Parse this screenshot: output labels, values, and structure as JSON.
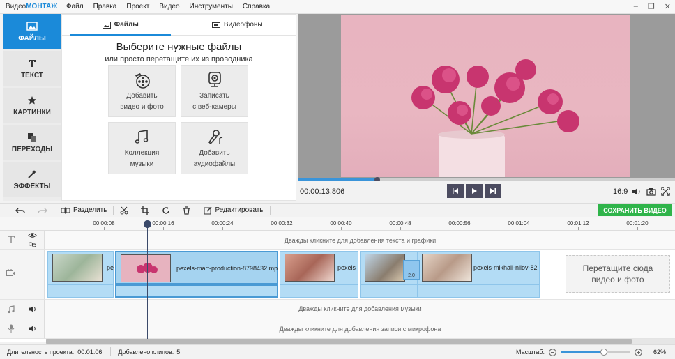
{
  "app": {
    "title_prefix": "Видео",
    "title_brand": "МОНТАЖ"
  },
  "menu": [
    "Файл",
    "Правка",
    "Проект",
    "Видео",
    "Инструменты",
    "Справка"
  ],
  "sidebar": {
    "items": [
      {
        "label": "ФАЙЛЫ",
        "icon": "image-icon",
        "active": true
      },
      {
        "label": "ТЕКСТ",
        "icon": "text-icon",
        "active": false
      },
      {
        "label": "КАРТИНКИ",
        "icon": "star-icon",
        "active": false
      },
      {
        "label": "ПЕРЕХОДЫ",
        "icon": "transitions-icon",
        "active": false
      },
      {
        "label": "ЭФФЕКТЫ",
        "icon": "magic-wand-icon",
        "active": false
      }
    ]
  },
  "files_panel": {
    "tabs": [
      {
        "label": "Файлы",
        "icon": "image-icon"
      },
      {
        "label": "Видеофоны",
        "icon": "film-icon"
      }
    ],
    "heading": "Выберите нужные файлы",
    "subheading": "или просто перетащите их из проводника",
    "tiles": [
      {
        "line1": "Добавить",
        "line2": "видео и фото",
        "icon": "film-reel-icon"
      },
      {
        "line1": "Записать",
        "line2": "с веб-камеры",
        "icon": "webcam-icon"
      },
      {
        "line1": "Коллекция",
        "line2": "музыки",
        "icon": "music-notes-icon"
      },
      {
        "line1": "Добавить",
        "line2": "аудиофайлы",
        "icon": "microphone-icon"
      }
    ]
  },
  "player": {
    "timecode": "00:00:13.806",
    "progress_fraction": 0.211,
    "aspect": "16:9"
  },
  "toolbar": {
    "split_label": "Разделить",
    "edit_label": "Редактировать",
    "save_label": "СОХРАНИТЬ ВИДЕО"
  },
  "ruler": {
    "ticks": [
      "00:00:08",
      "00:00:16",
      "00:00:24",
      "00:00:32",
      "00:00:40",
      "00:00:48",
      "00:00:56",
      "00:01:04",
      "00:01:12",
      "00:01:20"
    ]
  },
  "timeline": {
    "text_hint": "Дважды кликните для добавления текста и графики",
    "music_hint": "Дважды кликните для добавления музыки",
    "mic_hint": "Дважды кликните для добавления записи с микрофона",
    "dropzone": [
      "Перетащите сюда",
      "видео и фото"
    ],
    "clips": [
      {
        "label": "pe",
        "selected": false
      },
      {
        "label": "pexels-mart-production-8798432.mp",
        "selected": true
      },
      {
        "label": "pexels",
        "selected": false
      },
      {
        "label": "",
        "selected": false
      },
      {
        "label": "pexels-mikhail-nilov-82",
        "selected": false
      }
    ],
    "transition_value": "2.0"
  },
  "status": {
    "duration_label": "Длительность проекта:",
    "duration": "00:01:06",
    "clips_label": "Добавлено клипов:",
    "clips_count": "5",
    "scale_label": "Масштаб:",
    "zoom_percent": "62%",
    "zoom_fraction": 0.62
  },
  "colors": {
    "accent": "#1b8ad9",
    "save": "#2fb44a",
    "transport": "#4c4c60",
    "clip": "#b3dcf5"
  }
}
